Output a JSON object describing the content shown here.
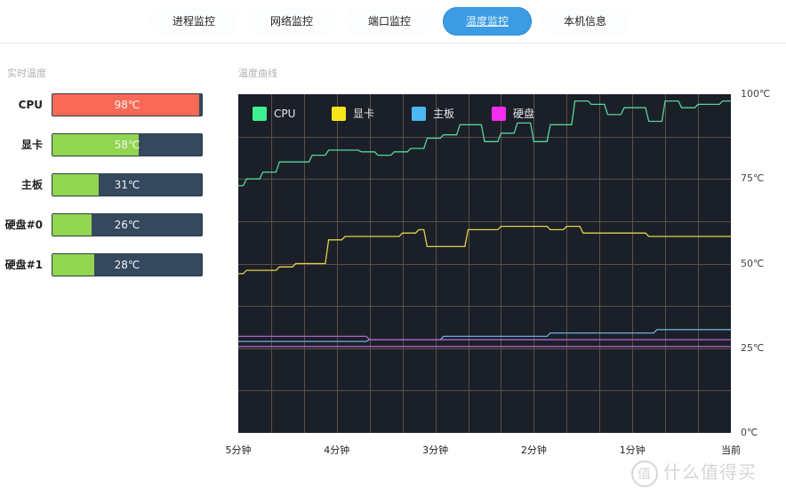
{
  "tabs": [
    {
      "label": "进程监控",
      "active": false
    },
    {
      "label": "网络监控",
      "active": false
    },
    {
      "label": "端口监控",
      "active": false
    },
    {
      "label": "温度监控",
      "active": true
    },
    {
      "label": "本机信息",
      "active": false
    }
  ],
  "realtime": {
    "title": "实时温度",
    "items": [
      {
        "label": "CPU",
        "value": 98,
        "value_text": "98℃",
        "color": "#f96a56"
      },
      {
        "label": "显卡",
        "value": 58,
        "value_text": "58℃",
        "color": "#92d550"
      },
      {
        "label": "主板",
        "value": 31,
        "value_text": "31℃",
        "color": "#92d550"
      },
      {
        "label": "硬盘#0",
        "value": 26,
        "value_text": "26℃",
        "color": "#92d550"
      },
      {
        "label": "硬盘#1",
        "value": 28,
        "value_text": "28℃",
        "color": "#92d550"
      }
    ],
    "track_color": "#34495e"
  },
  "curve": {
    "title": "温度曲线"
  },
  "chart_data": {
    "type": "line",
    "title": "温度曲线",
    "xlabel": "",
    "ylabel": "",
    "x_unit": "seconds ago",
    "x": [
      300,
      295,
      290,
      285,
      280,
      275,
      270,
      265,
      260,
      255,
      250,
      245,
      240,
      235,
      230,
      225,
      220,
      215,
      210,
      205,
      200,
      195,
      190,
      185,
      180,
      175,
      170,
      165,
      160,
      155,
      150,
      145,
      140,
      135,
      130,
      125,
      120,
      115,
      110,
      105,
      100,
      95,
      90,
      85,
      80,
      75,
      70,
      65,
      60,
      55,
      50,
      45,
      40,
      35,
      30,
      25,
      20,
      15,
      10,
      5,
      0
    ],
    "x_ticks": [
      {
        "at": 300,
        "label": "5分钟"
      },
      {
        "at": 240,
        "label": "4分钟"
      },
      {
        "at": 180,
        "label": "3分钟"
      },
      {
        "at": 120,
        "label": "2分钟"
      },
      {
        "at": 60,
        "label": "1分钟"
      },
      {
        "at": 0,
        "label": "当前"
      }
    ],
    "y_ticks": [
      {
        "at": 100,
        "label": "100℃"
      },
      {
        "at": 75,
        "label": "75℃"
      },
      {
        "at": 50,
        "label": "50℃"
      },
      {
        "at": 25,
        "label": "25℃"
      },
      {
        "at": 0,
        "label": "0℃"
      }
    ],
    "ylim": [
      0,
      100
    ],
    "grid": true,
    "grid_x_divisions": 15,
    "grid_y_divisions": 8,
    "legend_position": "top-left-inside",
    "background": "#1b2028",
    "grid_color": "#5a4f48",
    "series": [
      {
        "name": "CPU",
        "color": "#3ef08f",
        "line_color": "#58d49a",
        "values": [
          73,
          75,
          75,
          77,
          77,
          80,
          80,
          80,
          80,
          82,
          82,
          83.5,
          83.5,
          83.5,
          83.5,
          83,
          83,
          82,
          82,
          83,
          83,
          84,
          84,
          87,
          87,
          88,
          88,
          91,
          91,
          91,
          86,
          86,
          88.5,
          88.5,
          91.5,
          91.5,
          86,
          86,
          91,
          91,
          91,
          98,
          98,
          97,
          97,
          94,
          94,
          96,
          96,
          96,
          92,
          92,
          98,
          98,
          96,
          96,
          97,
          97,
          97,
          98,
          98
        ]
      },
      {
        "name": "显卡",
        "color": "#f7e51a",
        "line_color": "#e3d24a",
        "values": [
          47,
          48,
          48,
          48,
          48,
          49,
          49,
          50,
          50,
          50,
          50,
          57,
          57,
          58,
          58,
          58,
          58,
          58,
          58,
          58,
          59,
          59,
          60,
          55,
          55,
          55,
          55,
          55,
          60,
          60,
          60,
          60,
          61,
          61,
          61,
          61,
          61,
          61,
          60,
          60,
          61,
          61,
          59,
          59,
          59,
          59,
          59,
          59,
          59,
          59,
          58,
          58,
          58,
          58,
          58,
          58,
          58,
          58,
          58,
          58,
          58
        ]
      },
      {
        "name": "主板",
        "color": "#4cb7f2",
        "line_color": "#6aaedb",
        "values": [
          27,
          27,
          27,
          27,
          27,
          27,
          27,
          27,
          27,
          27,
          27,
          27,
          27,
          27,
          27,
          27,
          27.5,
          27.5,
          27.5,
          27.5,
          27.5,
          27.5,
          27.5,
          27.5,
          27.5,
          28.5,
          28.5,
          28.5,
          28.5,
          28.5,
          28.5,
          28.5,
          28.5,
          28.5,
          28.5,
          28.5,
          28.5,
          28.5,
          29.5,
          29.5,
          29.5,
          29.5,
          29.5,
          29.5,
          29.5,
          29.5,
          29.5,
          29.5,
          29.5,
          29.5,
          29.5,
          30.5,
          30.5,
          30.5,
          30.5,
          30.5,
          30.5,
          30.5,
          30.5,
          30.5,
          30.5
        ]
      },
      {
        "name": "硬盘",
        "color": "#f42df0",
        "line_color": "#b25fc8",
        "values": [
          28.5,
          28.5,
          28.5,
          28.5,
          28.5,
          28.5,
          28.5,
          28.5,
          28.5,
          28.5,
          28.5,
          28.5,
          28.5,
          28.5,
          28.5,
          28.5,
          27.5,
          27.5,
          27.5,
          27.5,
          27.5,
          27.5,
          27.5,
          27.5,
          27.5,
          27.5,
          27.5,
          27.5,
          27.5,
          27.5,
          27.5,
          27.5,
          27.5,
          27.5,
          27.5,
          27.5,
          27.5,
          27.5,
          27.5,
          27.5,
          27.5,
          27.5,
          27.5,
          27.5,
          27.5,
          27.5,
          27.5,
          27.5,
          27.5,
          27.5,
          27.5,
          27.5,
          27.5,
          27.5,
          27.5,
          27.5,
          27.5,
          27.5,
          27.5,
          27.5,
          27.5
        ]
      },
      {
        "name": "硬盘",
        "color": "#f42df0",
        "line_color": "#b25fc8",
        "legend": false,
        "values": [
          25.5,
          25.5,
          25.5,
          25.5,
          25.5,
          25.5,
          25.5,
          25.5,
          25.5,
          25.5,
          25.5,
          25.5,
          25.5,
          25.5,
          25.5,
          25.5,
          25.5,
          25.5,
          25.5,
          25.5,
          25.5,
          25.5,
          25.5,
          25.5,
          25.5,
          25.5,
          25.5,
          25.5,
          25.5,
          25.5,
          25.5,
          25.5,
          25.5,
          25.5,
          25.5,
          25.5,
          25.5,
          25.5,
          25.5,
          25.5,
          25.5,
          25.5,
          25.5,
          25.5,
          25.5,
          25.5,
          25.5,
          25.5,
          25.5,
          25.5,
          25.5,
          25.5,
          25.5,
          25.5,
          25.5,
          25.5,
          25.5,
          25.5,
          25.5,
          25.5,
          25.5
        ]
      }
    ]
  },
  "watermark": {
    "circle": "值",
    "text": "什么值得买"
  }
}
